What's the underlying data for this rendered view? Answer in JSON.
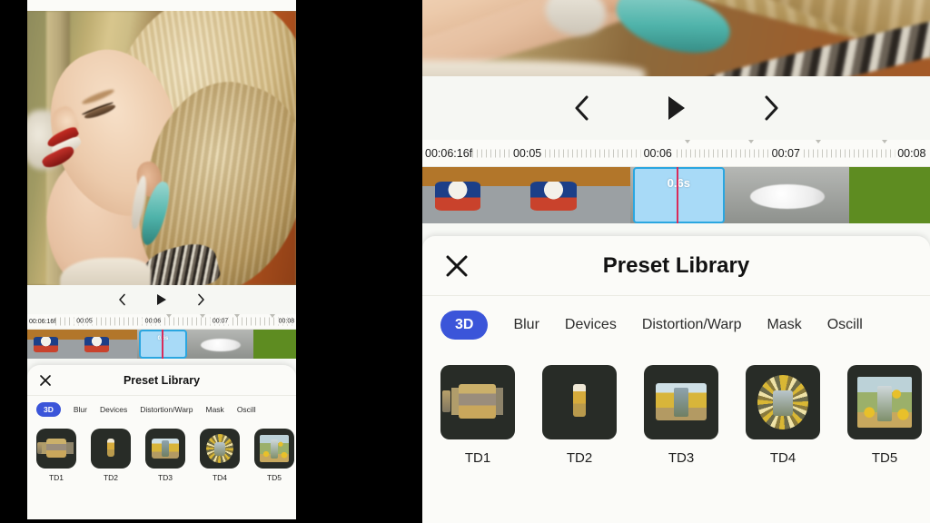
{
  "app": {
    "screens": [
      {
        "id": "left",
        "name": "phone-screen-full"
      },
      {
        "id": "right",
        "name": "phone-screen-zoomed"
      }
    ]
  },
  "transport": {
    "prev_label": "Previous frame",
    "play_label": "Play",
    "next_label": "Next frame",
    "prev_icon": "chevron-left-icon",
    "play_icon": "play-icon",
    "next_icon": "chevron-right-icon"
  },
  "timeline": {
    "current_time": "00:06:16f",
    "ruler_labels": [
      "00:05",
      "00:06",
      "00:07",
      "00:08"
    ],
    "selected_clip_duration": "0.6s",
    "playhead_color": "#d92b5a",
    "selected_clip_fill": "#a8daf7",
    "selected_clip_border": "#2aa6e0",
    "green_segment_color": "#5e8c21"
  },
  "sheet": {
    "title": "Preset Library",
    "close_icon": "close-icon",
    "active_tab_color": "#3b55d9",
    "tabs": [
      {
        "label": "3D",
        "active": true
      },
      {
        "label": "Blur",
        "active": false
      },
      {
        "label": "Devices",
        "active": false
      },
      {
        "label": "Distortion/Warp",
        "active": false
      },
      {
        "label": "Mask",
        "active": false
      },
      {
        "label": "Oscill",
        "active": false
      }
    ],
    "presets": [
      {
        "label": "TD1"
      },
      {
        "label": "TD2"
      },
      {
        "label": "TD3"
      },
      {
        "label": "TD4"
      },
      {
        "label": "TD5"
      }
    ],
    "thumb_background": "#282c27"
  }
}
